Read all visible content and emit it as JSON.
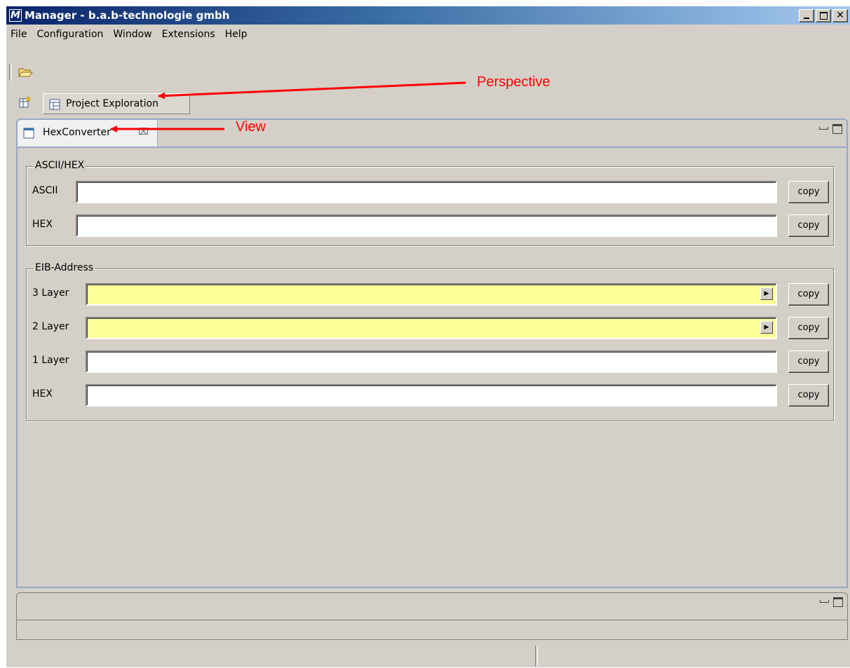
{
  "window": {
    "title": "Manager - b.a.b-technologie gmbh",
    "app_icon_letter": "M",
    "close_glyph": "✕"
  },
  "menu": [
    "File",
    "Configuration",
    "Window",
    "Extensions",
    "Help"
  ],
  "perspective": {
    "label": "Project Exploration"
  },
  "view": {
    "tab_label": "HexConverter",
    "close_glyph": "⌧",
    "groups": {
      "ascii_hex": {
        "title": "ASCII/HEX",
        "rows": [
          {
            "label": "ASCII",
            "value": "",
            "copy": "copy"
          },
          {
            "label": "HEX",
            "value": "",
            "copy": "copy"
          }
        ]
      },
      "eib": {
        "title": "EIB-Address",
        "rows": [
          {
            "label": "3 Layer",
            "value": "",
            "copy": "copy",
            "dropdown_glyph": "▶"
          },
          {
            "label": "2 Layer",
            "value": "",
            "copy": "copy",
            "dropdown_glyph": "▶"
          },
          {
            "label": "1 Layer",
            "value": "",
            "copy": "copy"
          },
          {
            "label": "HEX",
            "value": "",
            "copy": "copy"
          }
        ]
      }
    }
  },
  "annotations": {
    "perspective": "Perspective",
    "view": "View"
  },
  "colors": {
    "annotation": "#ff0000",
    "required_field": "#ffff99",
    "titlebar_start": "#0a246a",
    "titlebar_end": "#a6caf0"
  }
}
